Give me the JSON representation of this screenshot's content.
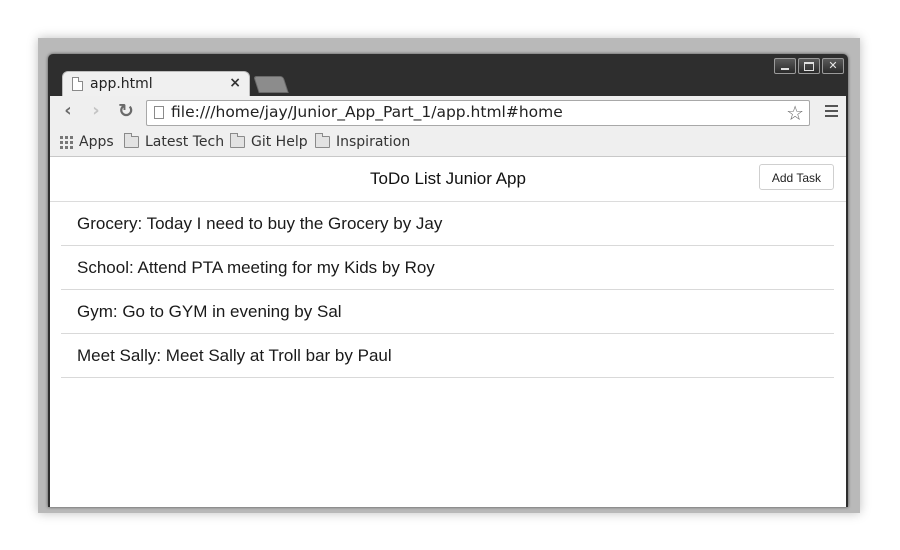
{
  "browser": {
    "tab_title": "app.html",
    "tab_close": "×",
    "url": "file:///home/jay/Junior_App_Part_1/app.html#home",
    "bookmarks": [
      {
        "label": "Apps",
        "icon": "apps-grid-icon"
      },
      {
        "label": "Latest Tech",
        "icon": "folder-icon"
      },
      {
        "label": "Git Help",
        "icon": "folder-icon"
      },
      {
        "label": "Inspiration",
        "icon": "folder-icon"
      }
    ]
  },
  "app": {
    "title": "ToDo List Junior App",
    "add_button_label": "Add Task",
    "tasks": [
      "Grocery: Today I need to buy the Grocery by Jay",
      "School: Attend PTA meeting for my Kids by Roy",
      "Gym: Go to GYM in evening by Sal",
      "Meet Sally: Meet Sally at Troll bar by Paul"
    ]
  }
}
